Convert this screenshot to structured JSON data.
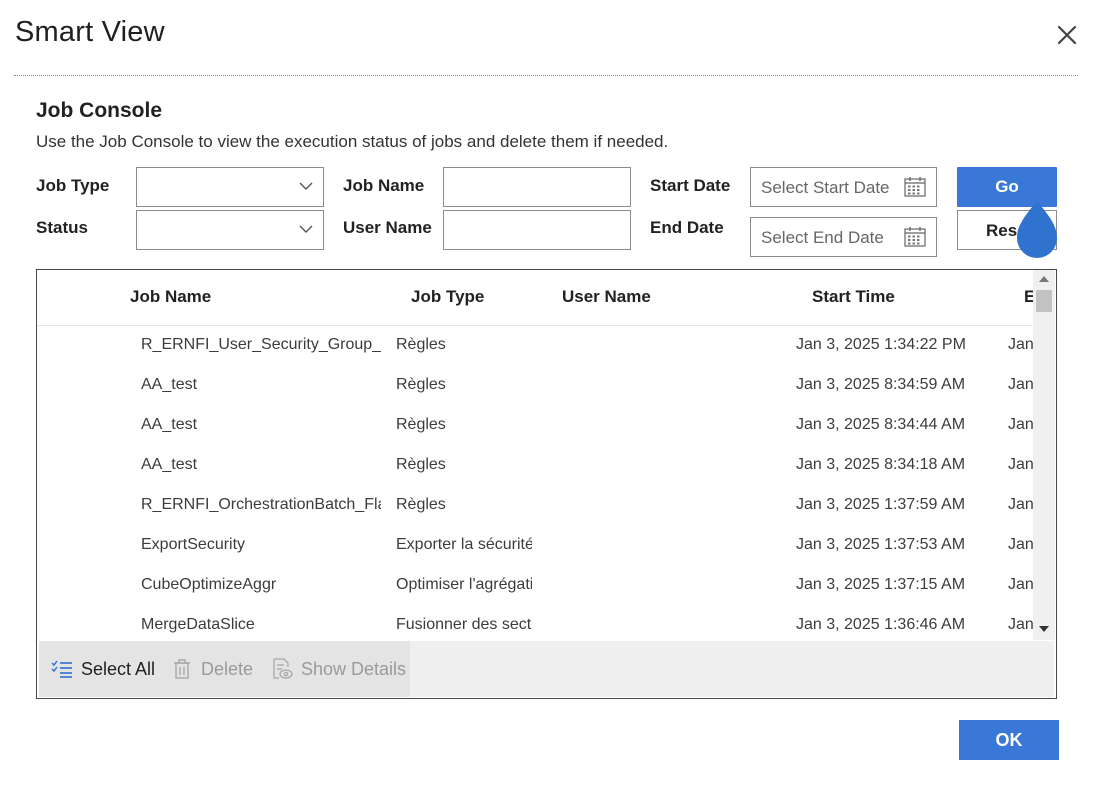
{
  "dialog": {
    "title": "Smart View"
  },
  "section": {
    "title": "Job Console",
    "description": "Use the Job Console to view the execution status of jobs and delete them if needed."
  },
  "filters": {
    "job_type_label": "Job Type",
    "status_label": "Status",
    "job_name_label": "Job Name",
    "user_name_label": "User Name",
    "start_date_label": "Start Date",
    "end_date_label": "End Date",
    "job_type_value": "",
    "status_value": "",
    "job_name_value": "",
    "user_name_value": "",
    "start_date_placeholder": "Select Start Date",
    "end_date_placeholder": "Select End Date",
    "go_label": "Go",
    "reset_label": "Reset"
  },
  "table": {
    "columns": [
      "Job Name",
      "Job Type",
      "User Name",
      "Start Time",
      "E"
    ],
    "rows": [
      {
        "job_name": "R_ERNFI_User_Security_Group_Cre",
        "job_type": "Règles",
        "user_name": "",
        "start_time": "Jan 3, 2025 1:34:22 PM",
        "end_time": "Jan"
      },
      {
        "job_name": "AA_test",
        "job_type": "Règles",
        "user_name": "",
        "start_time": "Jan 3, 2025 8:34:59 AM",
        "end_time": "Jan"
      },
      {
        "job_name": "AA_test",
        "job_type": "Règles",
        "user_name": "",
        "start_time": "Jan 3, 2025 8:34:44 AM",
        "end_time": "Jan"
      },
      {
        "job_name": "AA_test",
        "job_type": "Règles",
        "user_name": "",
        "start_time": "Jan 3, 2025 8:34:18 AM",
        "end_time": "Jan"
      },
      {
        "job_name": "R_ERNFI_OrchestrationBatch_Flag",
        "job_type": "Règles",
        "user_name": "",
        "start_time": "Jan 3, 2025 1:37:59 AM",
        "end_time": "Jan"
      },
      {
        "job_name": "ExportSecurity",
        "job_type": "Exporter la sécurité",
        "user_name": "",
        "start_time": "Jan 3, 2025 1:37:53 AM",
        "end_time": "Jan"
      },
      {
        "job_name": "CubeOptimizeAggr",
        "job_type": "Optimiser l'agrégati",
        "user_name": "",
        "start_time": "Jan 3, 2025 1:37:15 AM",
        "end_time": "Jan"
      },
      {
        "job_name": "MergeDataSlice",
        "job_type": "Fusionner des secte",
        "user_name": "",
        "start_time": "Jan 3, 2025 1:36:46 AM",
        "end_time": "Jan"
      }
    ]
  },
  "toolbar": {
    "select_all_label": "Select All",
    "delete_label": "Delete",
    "show_details_label": "Show Details"
  },
  "footer": {
    "ok_label": "OK"
  },
  "colors": {
    "primary": "#3a78d8",
    "toolbar_bg": "#efefef",
    "disabled_text": "#9a9a9a"
  },
  "icons": [
    "close-icon",
    "chevron-down-icon",
    "calendar-icon",
    "select-all-icon",
    "trash-icon",
    "show-details-icon",
    "touch-indicator"
  ]
}
